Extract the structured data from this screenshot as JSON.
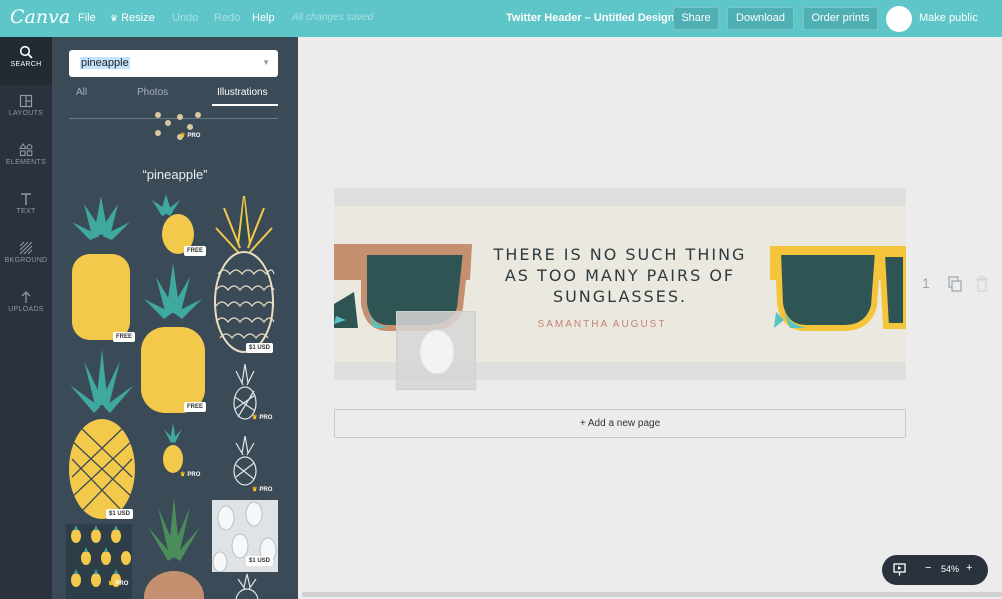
{
  "topbar": {
    "logo": "Canva",
    "file": "File",
    "resize": "Resize",
    "undo": "Undo",
    "redo": "Redo",
    "help": "Help",
    "saved_status": "All changes saved",
    "doc_title": "Twitter Header – Untitled Design",
    "share": "Share",
    "download": "Download",
    "order_prints": "Order prints",
    "make_public": "Make public"
  },
  "leftnav": {
    "items": [
      {
        "label": "SEARCH",
        "icon": "search-icon"
      },
      {
        "label": "LAYOUTS",
        "icon": "layouts-icon"
      },
      {
        "label": "ELEMENTS",
        "icon": "elements-icon"
      },
      {
        "label": "TEXT",
        "icon": "text-icon"
      },
      {
        "label": "BKGROUND",
        "icon": "background-icon"
      },
      {
        "label": "UPLOADS",
        "icon": "uploads-icon"
      }
    ]
  },
  "panel": {
    "search_value": "pineapple",
    "tabs": [
      "All",
      "Photos",
      "Illustrations"
    ],
    "active_tab": "Illustrations",
    "query_label": "“pineapple”",
    "badges": {
      "free": "FREE",
      "pro": "PRO",
      "usd": "$1 USD"
    }
  },
  "design": {
    "quote": "THERE IS NO SUCH THING AS TOO MANY PAIRS OF SUNGLASSES.",
    "author": "SAMANTHA AUGUST"
  },
  "page_number": "1",
  "add_page": "+ Add a new page",
  "zoom": {
    "minus": "−",
    "level": "54%",
    "plus": "+"
  },
  "colors": {
    "topbar": "#5ec6c9",
    "nav": "#2a333d",
    "panel": "#3a4a56",
    "pineapple_yellow": "#f3c94b",
    "leaf_teal": "#3fa89f",
    "glasses_brown": "#c5906f",
    "glasses_yellow": "#f4c53a",
    "lens": "#2e5453"
  }
}
